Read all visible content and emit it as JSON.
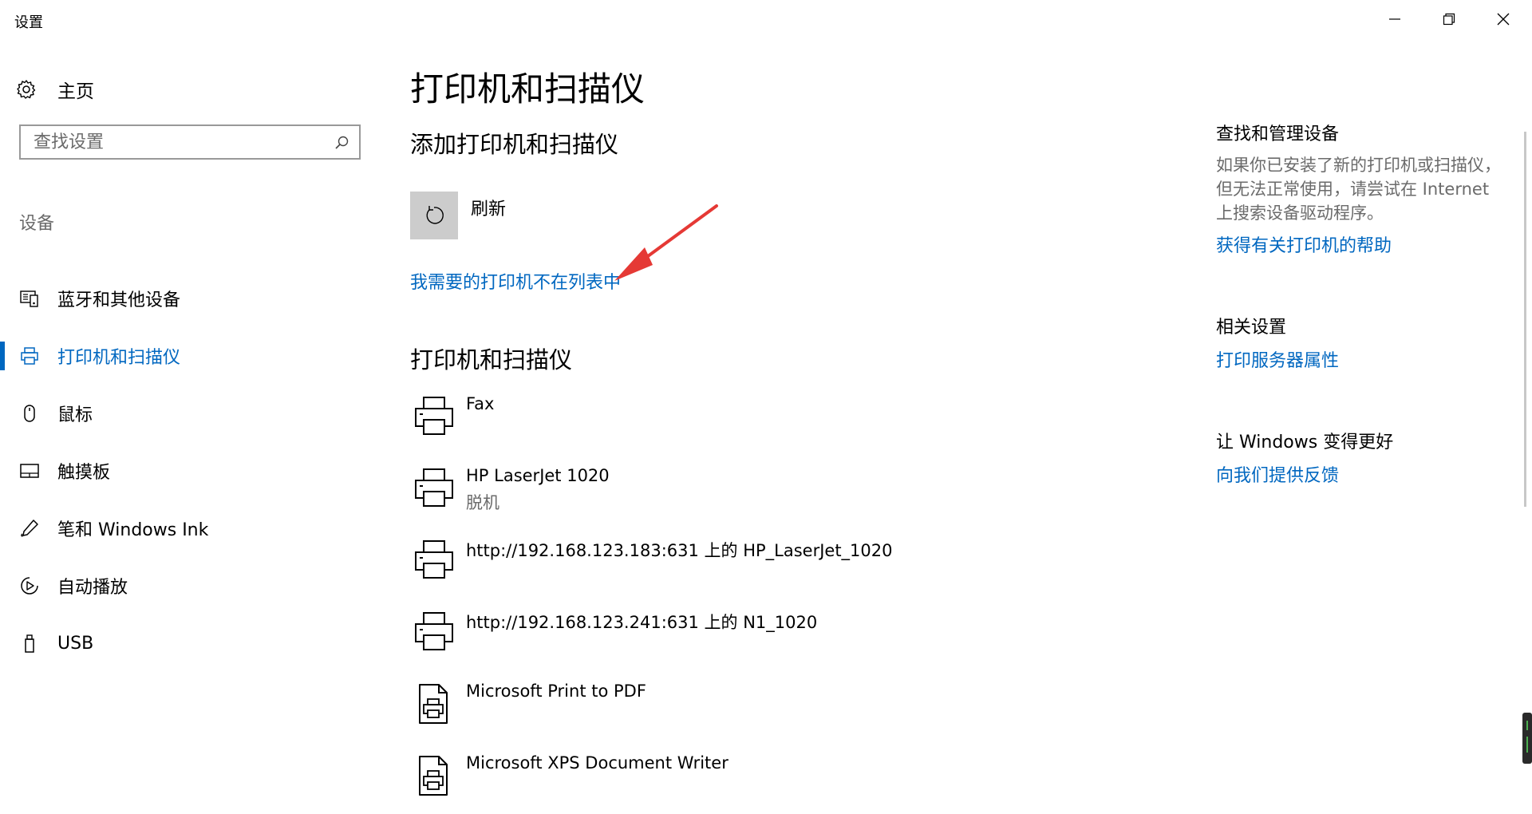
{
  "window": {
    "title": "设置"
  },
  "sidebar": {
    "home_label": "主页",
    "search_placeholder": "查找设置",
    "section_label": "设备",
    "items": [
      {
        "label": "蓝牙和其他设备",
        "icon": "bluetooth-devices-icon",
        "active": false
      },
      {
        "label": "打印机和扫描仪",
        "icon": "printer-icon",
        "active": true
      },
      {
        "label": "鼠标",
        "icon": "mouse-icon",
        "active": false
      },
      {
        "label": "触摸板",
        "icon": "touchpad-icon",
        "active": false
      },
      {
        "label": "笔和 Windows Ink",
        "icon": "pen-icon",
        "active": false
      },
      {
        "label": "自动播放",
        "icon": "autoplay-icon",
        "active": false
      },
      {
        "label": "USB",
        "icon": "usb-icon",
        "active": false
      }
    ]
  },
  "main": {
    "title": "打印机和扫描仪",
    "add_heading": "添加打印机和扫描仪",
    "refresh_label": "刷新",
    "missing_link": "我需要的打印机不在列表中",
    "printers_heading": "打印机和扫描仪",
    "devices": [
      {
        "name": "Fax",
        "status": "",
        "icon": "printer-icon"
      },
      {
        "name": "HP LaserJet 1020",
        "status": "脱机",
        "icon": "printer-icon"
      },
      {
        "name": "http://192.168.123.183:631 上的 HP_LaserJet_1020",
        "status": "",
        "icon": "printer-icon"
      },
      {
        "name": "http://192.168.123.241:631 上的 N1_1020",
        "status": "",
        "icon": "printer-icon"
      },
      {
        "name": "Microsoft Print to PDF",
        "status": "",
        "icon": "document-printer-icon"
      },
      {
        "name": "Microsoft XPS Document Writer",
        "status": "",
        "icon": "document-printer-icon"
      }
    ]
  },
  "right": {
    "manage_heading": "查找和管理设备",
    "manage_text": "如果你已安装了新的打印机或扫描仪，但无法正常使用，请尝试在 Internet 上搜索设备驱动程序。",
    "manage_link": "获得有关打印机的帮助",
    "related_heading": "相关设置",
    "related_link": "打印服务器属性",
    "feedback_heading": "让 Windows 变得更好",
    "feedback_link": "向我们提供反馈"
  },
  "colors": {
    "accent": "#0067c0",
    "secondary_text": "#6b6b6b",
    "annotation_arrow": "#e53935"
  }
}
